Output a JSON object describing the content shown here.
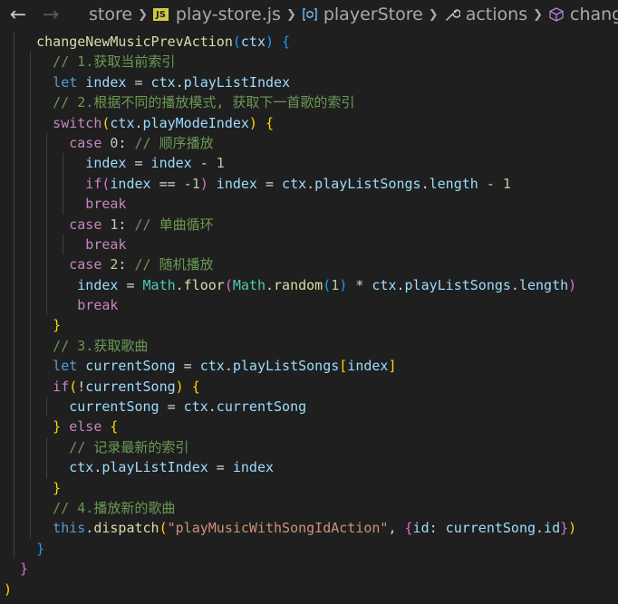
{
  "breadcrumbs": [
    {
      "name": "crumb-store",
      "label": "store",
      "icon": null
    },
    {
      "name": "crumb-play-store-file",
      "label": "play-store.js",
      "icon": "js-file-icon"
    },
    {
      "name": "crumb-player-store",
      "label": "playerStore",
      "icon": "variable-icon"
    },
    {
      "name": "crumb-actions",
      "label": "actions",
      "icon": "wrench-icon"
    },
    {
      "name": "crumb-change-action",
      "label": "chang",
      "icon": "cube-icon"
    }
  ],
  "icons": {
    "back": "arrow-left-icon",
    "forward": "arrow-right-icon",
    "separator": "chevron-right-icon",
    "js_badge_text": "JS"
  },
  "colors": {
    "background": "#1f1f1f",
    "keyword": "#569cd6",
    "control": "#c586c0",
    "function": "#dcdcaa",
    "variable": "#9cdcfe",
    "class": "#4ec9b0",
    "number": "#b5cea8",
    "string": "#ce9178",
    "comment": "#6a9955",
    "bracket_gold": "#ffd700",
    "bracket_orchid": "#da70d6",
    "bracket_blue": "#179fff"
  },
  "code_lines": [
    {
      "indent": 4,
      "guides": [
        1
      ],
      "tokens": [
        [
          "fn",
          "changeNewMusicPrevAction"
        ],
        [
          "b3",
          "("
        ],
        [
          "var",
          "ctx"
        ],
        [
          "b3",
          ")"
        ],
        [
          "p",
          " "
        ],
        [
          "b3",
          "{"
        ]
      ]
    },
    {
      "indent": 6,
      "guides": [
        1,
        3
      ],
      "tokens": [
        [
          "cmt",
          "// 1.获取当前索引"
        ]
      ]
    },
    {
      "indent": 6,
      "guides": [
        1,
        3
      ],
      "tokens": [
        [
          "kw",
          "let"
        ],
        [
          "p",
          " "
        ],
        [
          "var",
          "index"
        ],
        [
          "op",
          " = "
        ],
        [
          "var",
          "ctx"
        ],
        [
          "p",
          "."
        ],
        [
          "prop",
          "playListIndex"
        ]
      ]
    },
    {
      "indent": 6,
      "guides": [
        1,
        3
      ],
      "tokens": [
        [
          "cmt",
          "// 2.根据不同的播放模式, 获取下一首歌的索引"
        ]
      ]
    },
    {
      "indent": 6,
      "guides": [
        1,
        3
      ],
      "tokens": [
        [
          "ctrl",
          "switch"
        ],
        [
          "b1",
          "("
        ],
        [
          "var",
          "ctx"
        ],
        [
          "p",
          "."
        ],
        [
          "prop",
          "playModeIndex"
        ],
        [
          "b1",
          ")"
        ],
        [
          "p",
          " "
        ],
        [
          "b1",
          "{"
        ]
      ]
    },
    {
      "indent": 8,
      "guides": [
        1,
        3,
        5
      ],
      "tokens": [
        [
          "ctrl",
          "case"
        ],
        [
          "p",
          " "
        ],
        [
          "num",
          "0"
        ],
        [
          "p",
          ": "
        ],
        [
          "cmt",
          "// 顺序播放"
        ]
      ]
    },
    {
      "indent": 10,
      "guides": [
        1,
        3,
        5,
        7
      ],
      "tokens": [
        [
          "var",
          "index"
        ],
        [
          "op",
          " = "
        ],
        [
          "var",
          "index"
        ],
        [
          "op",
          " - "
        ],
        [
          "num",
          "1"
        ]
      ]
    },
    {
      "indent": 10,
      "guides": [
        1,
        3,
        5,
        7
      ],
      "tokens": [
        [
          "ctrl",
          "if"
        ],
        [
          "b2",
          "("
        ],
        [
          "var",
          "index"
        ],
        [
          "op",
          " == "
        ],
        [
          "op",
          "-"
        ],
        [
          "num",
          "1"
        ],
        [
          "b2",
          ")"
        ],
        [
          "p",
          " "
        ],
        [
          "var",
          "index"
        ],
        [
          "op",
          " = "
        ],
        [
          "var",
          "ctx"
        ],
        [
          "p",
          "."
        ],
        [
          "prop",
          "playListSongs"
        ],
        [
          "p",
          "."
        ],
        [
          "prop",
          "length"
        ],
        [
          "op",
          " - "
        ],
        [
          "num",
          "1"
        ]
      ]
    },
    {
      "indent": 10,
      "guides": [
        1,
        3,
        5,
        7
      ],
      "tokens": [
        [
          "ctrl",
          "break"
        ]
      ]
    },
    {
      "indent": 8,
      "guides": [
        1,
        3,
        5
      ],
      "tokens": [
        [
          "ctrl",
          "case"
        ],
        [
          "p",
          " "
        ],
        [
          "num",
          "1"
        ],
        [
          "p",
          ": "
        ],
        [
          "cmt",
          "// 单曲循环"
        ]
      ]
    },
    {
      "indent": 10,
      "guides": [
        1,
        3,
        5,
        7
      ],
      "tokens": [
        [
          "ctrl",
          "break"
        ]
      ]
    },
    {
      "indent": 8,
      "guides": [
        1,
        3,
        5
      ],
      "tokens": [
        [
          "ctrl",
          "case"
        ],
        [
          "p",
          " "
        ],
        [
          "num",
          "2"
        ],
        [
          "p",
          ": "
        ],
        [
          "cmt",
          "// 随机播放"
        ]
      ]
    },
    {
      "indent": 9,
      "guides": [
        1,
        3,
        5
      ],
      "tokens": [
        [
          "var",
          "index"
        ],
        [
          "op",
          " = "
        ],
        [
          "cls",
          "Math"
        ],
        [
          "p",
          "."
        ],
        [
          "fn",
          "floor"
        ],
        [
          "b2",
          "("
        ],
        [
          "cls",
          "Math"
        ],
        [
          "p",
          "."
        ],
        [
          "fn",
          "random"
        ],
        [
          "b3",
          "("
        ],
        [
          "num",
          "1"
        ],
        [
          "b3",
          ")"
        ],
        [
          "op",
          " * "
        ],
        [
          "var",
          "ctx"
        ],
        [
          "p",
          "."
        ],
        [
          "prop",
          "playListSongs"
        ],
        [
          "p",
          "."
        ],
        [
          "prop",
          "length"
        ],
        [
          "b2",
          ")"
        ]
      ]
    },
    {
      "indent": 9,
      "guides": [
        1,
        3,
        5
      ],
      "tokens": [
        [
          "ctrl",
          "break"
        ]
      ]
    },
    {
      "indent": 6,
      "guides": [
        1,
        3
      ],
      "tokens": [
        [
          "b1",
          "}"
        ]
      ]
    },
    {
      "indent": 6,
      "guides": [
        1,
        3
      ],
      "tokens": [
        [
          "cmt",
          "// 3.获取歌曲"
        ]
      ]
    },
    {
      "indent": 6,
      "guides": [
        1,
        3
      ],
      "tokens": [
        [
          "kw",
          "let"
        ],
        [
          "p",
          " "
        ],
        [
          "var",
          "currentSong"
        ],
        [
          "op",
          " = "
        ],
        [
          "var",
          "ctx"
        ],
        [
          "p",
          "."
        ],
        [
          "prop",
          "playListSongs"
        ],
        [
          "b1",
          "["
        ],
        [
          "var",
          "index"
        ],
        [
          "b1",
          "]"
        ]
      ]
    },
    {
      "indent": 6,
      "guides": [
        1,
        3
      ],
      "tokens": [
        [
          "ctrl",
          "if"
        ],
        [
          "b1",
          "("
        ],
        [
          "op",
          "!"
        ],
        [
          "var",
          "currentSong"
        ],
        [
          "b1",
          ")"
        ],
        [
          "p",
          " "
        ],
        [
          "b1",
          "{"
        ]
      ]
    },
    {
      "indent": 8,
      "guides": [
        1,
        3,
        5
      ],
      "tokens": [
        [
          "var",
          "currentSong"
        ],
        [
          "op",
          " = "
        ],
        [
          "var",
          "ctx"
        ],
        [
          "p",
          "."
        ],
        [
          "prop",
          "currentSong"
        ]
      ]
    },
    {
      "indent": 6,
      "guides": [
        1,
        3
      ],
      "tokens": [
        [
          "b1",
          "}"
        ],
        [
          "p",
          " "
        ],
        [
          "ctrl",
          "else"
        ],
        [
          "p",
          " "
        ],
        [
          "b1",
          "{"
        ]
      ]
    },
    {
      "indent": 8,
      "guides": [
        1,
        3,
        5
      ],
      "tokens": [
        [
          "cmt",
          "// 记录最新的索引"
        ]
      ]
    },
    {
      "indent": 8,
      "guides": [
        1,
        3,
        5
      ],
      "tokens": [
        [
          "var",
          "ctx"
        ],
        [
          "p",
          "."
        ],
        [
          "prop",
          "playListIndex"
        ],
        [
          "op",
          " = "
        ],
        [
          "var",
          "index"
        ]
      ]
    },
    {
      "indent": 6,
      "guides": [
        1,
        3
      ],
      "tokens": [
        [
          "b1",
          "}"
        ]
      ]
    },
    {
      "indent": 6,
      "guides": [
        1,
        3
      ],
      "tokens": [
        [
          "cmt",
          "// 4.播放新的歌曲"
        ]
      ]
    },
    {
      "indent": 6,
      "guides": [
        1,
        3
      ],
      "tokens": [
        [
          "kw",
          "this"
        ],
        [
          "p",
          "."
        ],
        [
          "fn",
          "dispatch"
        ],
        [
          "b1",
          "("
        ],
        [
          "str",
          "\"playMusicWithSongIdAction\""
        ],
        [
          "p",
          ", "
        ],
        [
          "b2",
          "{"
        ],
        [
          "prop",
          "id"
        ],
        [
          "p",
          ": "
        ],
        [
          "var",
          "currentSong"
        ],
        [
          "p",
          "."
        ],
        [
          "prop",
          "id"
        ],
        [
          "b2",
          "}"
        ],
        [
          "b1",
          ")"
        ]
      ]
    },
    {
      "indent": 4,
      "guides": [
        1
      ],
      "tokens": [
        [
          "b3",
          "}"
        ]
      ]
    },
    {
      "indent": 2,
      "guides": [],
      "tokens": [
        [
          "b2",
          "}"
        ]
      ]
    },
    {
      "indent": 0,
      "guides": [],
      "tokens": [
        [
          "b1",
          ")"
        ]
      ]
    }
  ]
}
